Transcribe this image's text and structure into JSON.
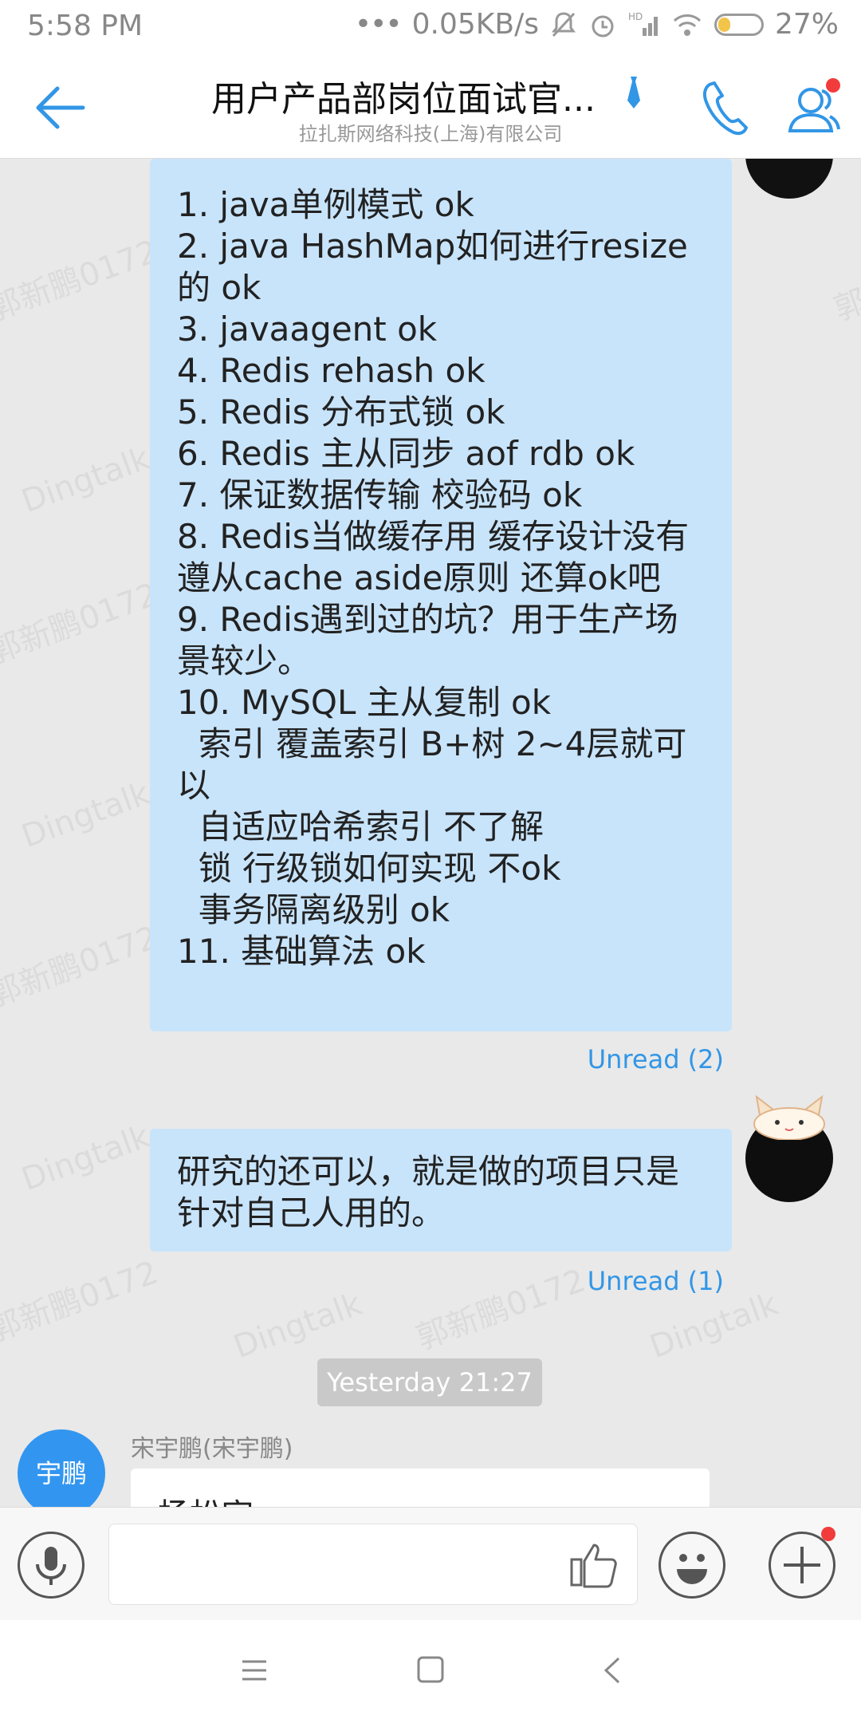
{
  "status": {
    "time": "5:58 PM",
    "net_speed": "0.05KB/s",
    "battery": "27%",
    "battery_level": 0.27
  },
  "header": {
    "title": "用户产品部岗位面试官...",
    "subtitle": "拉扎斯网络科技(上海)有限公司"
  },
  "messages": {
    "first": {
      "lines": [
        "1. java单例模式 ok",
        "2. java HashMap如何进行resize的 ok",
        "3. javaagent ok",
        "4. Redis rehash ok",
        "5. Redis 分布式锁 ok",
        "6. Redis 主从同步 aof rdb ok",
        "7. 保证数据传输 校验码 ok",
        "8. Redis当做缓存用 缓存设计没有遵从cache aside原则 还算ok吧",
        "9. Redis遇到过的坑？用于生产场景较少。",
        "10. MySQL 主从复制 ok",
        "  索引 覆盖索引 B+树 2~4层就可以",
        "  自适应哈希索引 不了解",
        "  锁 行级锁如何实现 不ok",
        "  事务隔离级别 ok",
        "11. 基础算法 ok"
      ],
      "unread": "Unread (2)"
    },
    "second": {
      "text": "研究的还可以，就是做的项目只是针对自己人用的。",
      "unread": "Unread (1)"
    },
    "timestamp": "Yesterday 21:27",
    "third": {
      "avatar_text": "宇鹏",
      "sender": "宋宇鹏(宋宇鹏)",
      "text_partial": "杨松宇"
    }
  },
  "watermark": {
    "name": "郭新鹏0172",
    "app": "Dingtalk"
  },
  "colors": {
    "accent": "#3296e6",
    "bubble": "#c8e4fb",
    "badge": "#f23c3c"
  }
}
